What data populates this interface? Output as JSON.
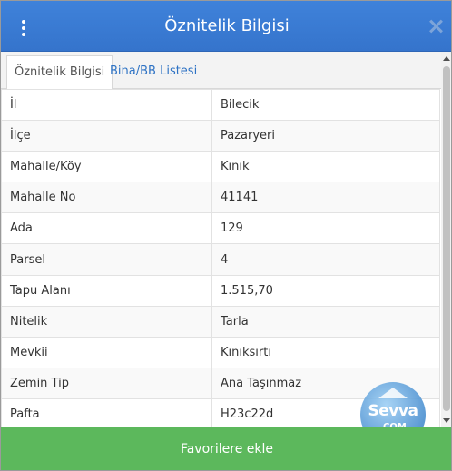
{
  "dialog": {
    "title": "Öznitelik Bilgisi"
  },
  "tabs": [
    {
      "label": "Öznitelik Bilgisi",
      "active": true
    },
    {
      "label": "Bina/BB Listesi",
      "active": false
    }
  ],
  "attributes": [
    {
      "key": "İl",
      "value": "Bilecik"
    },
    {
      "key": "İlçe",
      "value": "Pazaryeri"
    },
    {
      "key": "Mahalle/Köy",
      "value": "Kınık"
    },
    {
      "key": "Mahalle No",
      "value": "41141"
    },
    {
      "key": "Ada",
      "value": "129"
    },
    {
      "key": "Parsel",
      "value": "4"
    },
    {
      "key": "Tapu Alanı",
      "value": "1.515,70"
    },
    {
      "key": "Nitelik",
      "value": "Tarla"
    },
    {
      "key": "Mevkii",
      "value": "Kınıksırtı"
    },
    {
      "key": "Zemin Tip",
      "value": "Ana Taşınmaz"
    },
    {
      "key": "Pafta",
      "value": "H23c22d"
    }
  ],
  "actions": {
    "favorite_label": "Favorilere ekle"
  },
  "watermark": {
    "text": "Sevva",
    "sub": ".COM"
  },
  "colors": {
    "header": "#3a7bd5",
    "tab_link": "#2d72c4",
    "favorite_button": "#5cb85c"
  },
  "icons": [
    "more-vertical-icon",
    "close-icon"
  ]
}
